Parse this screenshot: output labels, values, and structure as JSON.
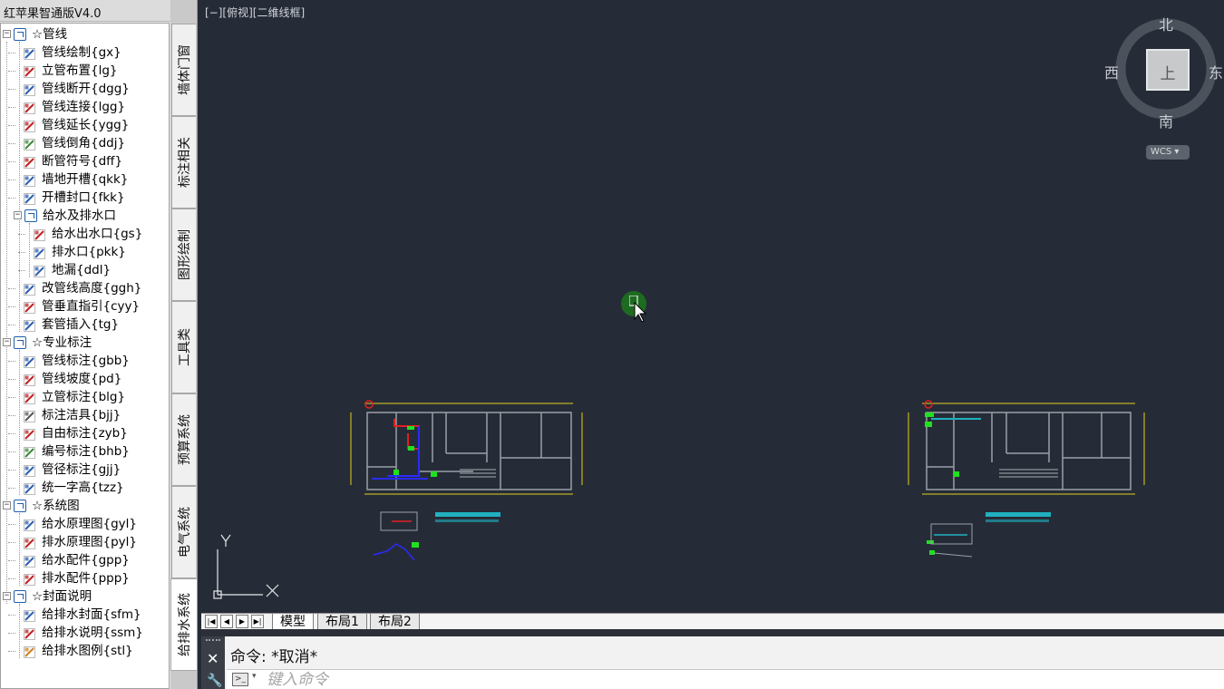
{
  "panel": {
    "title": "红苹果智通版V4.0",
    "tree": [
      {
        "level": 0,
        "label": "☆管线",
        "expander": "−",
        "type": "folder"
      },
      {
        "level": 1,
        "label": "管线绘制{gx}",
        "icon": "pipe-draw-icon",
        "color": "#2b5fb0"
      },
      {
        "level": 1,
        "label": "立管布置{lg}",
        "icon": "riser-layout-icon",
        "color": "#c02020"
      },
      {
        "level": 1,
        "label": "管线断开{dgg}",
        "icon": "pipe-break-icon",
        "color": "#2b5fb0"
      },
      {
        "level": 1,
        "label": "管线连接{lgg}",
        "icon": "pipe-connect-icon",
        "color": "#c02020"
      },
      {
        "level": 1,
        "label": "管线延长{ygg}",
        "icon": "pipe-extend-icon",
        "color": "#c02020"
      },
      {
        "level": 1,
        "label": "管线倒角{ddj}",
        "icon": "pipe-chamfer-icon",
        "color": "#3a8a3a"
      },
      {
        "level": 1,
        "label": "断管符号{dff}",
        "icon": "pipe-break-symbol-icon",
        "color": "#c02020"
      },
      {
        "level": 1,
        "label": "墙地开槽{qkk}",
        "icon": "wall-groove-icon",
        "color": "#2b5fb0"
      },
      {
        "level": 1,
        "label": "开槽封口{fkk}",
        "icon": "groove-seal-icon",
        "color": "#2b5fb0"
      },
      {
        "level": 1,
        "label": "给水及排水口",
        "expander": "−",
        "type": "folder"
      },
      {
        "level": 2,
        "label": "给水出水口{gs}",
        "icon": "water-outlet-icon",
        "color": "#c02020"
      },
      {
        "level": 2,
        "label": "排水口{pkk}",
        "icon": "drain-icon",
        "color": "#2b5fb0"
      },
      {
        "level": 2,
        "label": "地漏{ddl}",
        "icon": "floor-drain-icon",
        "color": "#2b5fb0"
      },
      {
        "level": 1,
        "label": "改管线高度{ggh}",
        "icon": "pipe-height-icon",
        "color": "#2b5fb0"
      },
      {
        "level": 1,
        "label": "管垂直指引{cyy}",
        "icon": "vertical-leader-icon",
        "color": "#c02020"
      },
      {
        "level": 1,
        "label": "套管插入{tg}",
        "icon": "sleeve-insert-icon",
        "color": "#2b5fb0"
      },
      {
        "level": 0,
        "label": "☆专业标注",
        "expander": "−",
        "type": "folder"
      },
      {
        "level": 1,
        "label": "管线标注{gbb}",
        "icon": "pipe-annotation-icon",
        "color": "#2b5fb0"
      },
      {
        "level": 1,
        "label": "管线坡度{pd}",
        "icon": "pipe-slope-icon",
        "color": "#c02020"
      },
      {
        "level": 1,
        "label": "立管标注{blg}",
        "icon": "riser-annotation-icon",
        "color": "#c02020"
      },
      {
        "level": 1,
        "label": "标注洁具{bjj}",
        "icon": "fixture-annotation-icon",
        "color": "#555555"
      },
      {
        "level": 1,
        "label": "自由标注{zyb}",
        "icon": "free-annotation-icon",
        "color": "#c02020"
      },
      {
        "level": 1,
        "label": "编号标注{bhb}",
        "icon": "number-annotation-icon",
        "color": "#3a8a3a"
      },
      {
        "level": 1,
        "label": "管径标注{gjj}",
        "icon": "diameter-annotation-icon",
        "color": "#2b5fb0"
      },
      {
        "level": 1,
        "label": "统一字高{tzz}",
        "icon": "text-height-icon",
        "color": "#2b5fb0"
      },
      {
        "level": 0,
        "label": "☆系统图",
        "expander": "−",
        "type": "folder"
      },
      {
        "level": 1,
        "label": "给水原理图{gyl}",
        "icon": "supply-diagram-icon",
        "color": "#2b5fb0"
      },
      {
        "level": 1,
        "label": "排水原理图{pyl}",
        "icon": "drain-diagram-icon",
        "color": "#c02020"
      },
      {
        "level": 1,
        "label": "给水配件{gpp}",
        "icon": "supply-fitting-icon",
        "color": "#2b5fb0"
      },
      {
        "level": 1,
        "label": "排水配件{ppp}",
        "icon": "drain-fitting-icon",
        "color": "#c02020"
      },
      {
        "level": 0,
        "label": "☆封面说明",
        "expander": "−",
        "type": "folder"
      },
      {
        "level": 1,
        "label": "给排水封面{sfm}",
        "icon": "cover-icon",
        "color": "#2b5fb0"
      },
      {
        "level": 1,
        "label": "给排水说明{ssm}",
        "icon": "description-icon",
        "color": "#c02020"
      },
      {
        "level": 1,
        "label": "给排水图例{stl}",
        "icon": "legend-icon",
        "color": "#d08020"
      }
    ]
  },
  "vtabs": [
    {
      "label": "墙体门窗",
      "active": false
    },
    {
      "label": "标注相关",
      "active": false
    },
    {
      "label": "图形绘制",
      "active": false
    },
    {
      "label": "工具类",
      "active": false
    },
    {
      "label": "预算系统",
      "active": false
    },
    {
      "label": "电气系统",
      "active": false
    },
    {
      "label": "给排水系统",
      "active": true
    }
  ],
  "canvas": {
    "view_label": "[−][俯视][二维线框]",
    "compass": {
      "north": "北",
      "south": "南",
      "east": "东",
      "west": "西",
      "top": "上"
    },
    "wcs": "WCS ▾",
    "ucs": {
      "y": "Y",
      "x": "X"
    }
  },
  "layout_tabs": {
    "nav": [
      "|◀",
      "◀",
      "▶",
      "▶|"
    ],
    "tabs": [
      {
        "label": "模型",
        "active": true
      },
      {
        "label": "布局1",
        "active": false
      },
      {
        "label": "布局2",
        "active": false
      }
    ]
  },
  "command": {
    "history": "命令:  *取消*",
    "placeholder": "键入命令",
    "close": "✕",
    "wrench": "🔧",
    "prompt_icon": ">_",
    "caret": "▾"
  },
  "colors": {
    "canvas_bg": "#262c37",
    "drawing_gray": "#9aa0a8",
    "pipe_red": "#e02020",
    "pipe_blue": "#2a2aff",
    "green": "#20e020",
    "cyan": "#20b0c0",
    "yellow": "#e0d020"
  }
}
